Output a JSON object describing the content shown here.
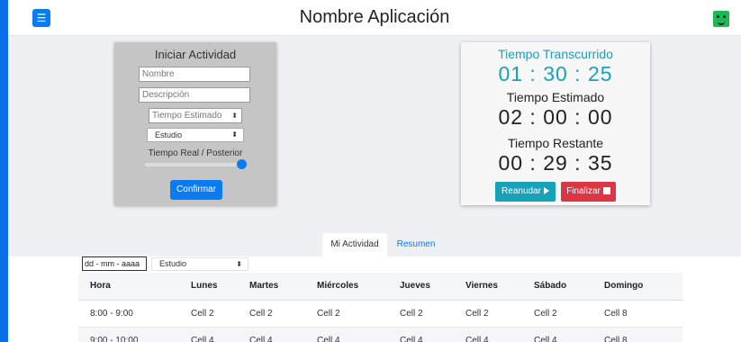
{
  "header": {
    "title": "Nombre Aplicación",
    "menu_icon": "hamburger-icon",
    "menu_glyph": "☰",
    "avatar_icon": "user-avatar-icon",
    "accent": "#0b6fe8"
  },
  "form": {
    "title": "Iniciar Actividad",
    "nombre_placeholder": "Nombre",
    "descripcion_placeholder": "Descripción",
    "tiempo_placeholder": "Tiempo Estimado",
    "categoria": "Estudio",
    "slider_label": "Tiempo Real / Posterior",
    "slider_value": 1.0,
    "confirm_label": "Confirmar"
  },
  "timer": {
    "elapsed_label": "Tiempo Transcurrido",
    "elapsed_value": "01 : 30 : 25",
    "estimated_label": "Tiempo Estimado",
    "estimated_value": "02 : 00 : 00",
    "remaining_label": "Tiempo Restante",
    "remaining_value": "00 : 29 : 35",
    "resume_label": "Reanudar",
    "finish_label": "Finalizar",
    "resume_color": "#17a2b8",
    "finish_color": "#dc3545"
  },
  "tabs": [
    {
      "label": "Mi Actividad",
      "active": true
    },
    {
      "label": "Resumen",
      "active": false
    }
  ],
  "filters": {
    "date_placeholder": "dd - mm - aaaa",
    "category": "Estudio"
  },
  "table": {
    "headers": [
      "Hora",
      "Lunes",
      "Martes",
      "Miércoles",
      "Jueves",
      "Viernes",
      "Sábado",
      "Domingo"
    ],
    "rows": [
      [
        "8:00 - 9:00",
        "Cell 2",
        "Cell 2",
        "Cell 2",
        "Cell 2",
        "Cell 2",
        "Cell 2",
        "Cell 8"
      ],
      [
        "9:00 - 10:00",
        "Cell 4",
        "Cell 4",
        "Cell 4",
        "Cell 4",
        "Cell 4",
        "Cell 4",
        "Cell 8"
      ]
    ]
  }
}
